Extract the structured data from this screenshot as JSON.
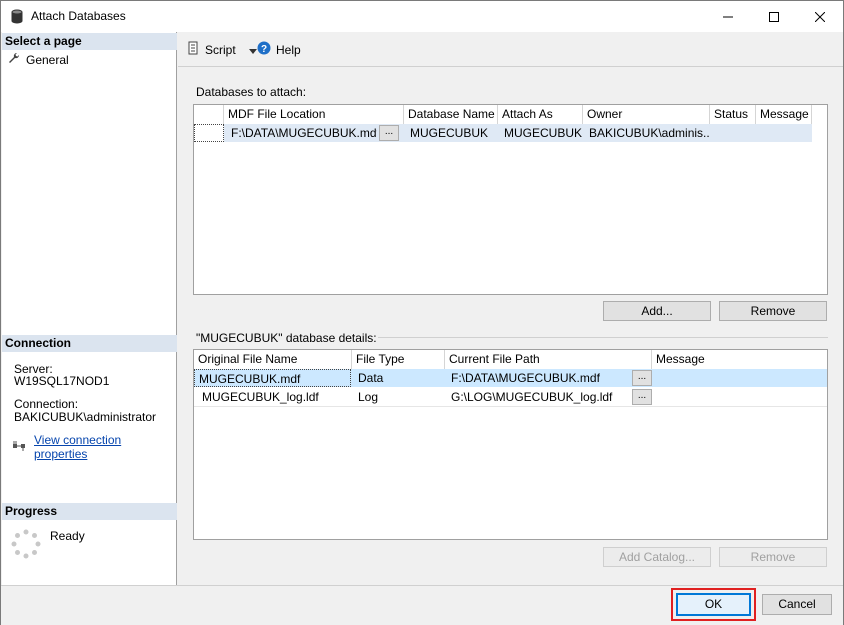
{
  "window": {
    "title": "Attach Databases"
  },
  "left": {
    "select_page_header": "Select a page",
    "pages": [
      {
        "label": "General"
      }
    ],
    "connection_header": "Connection",
    "server_label": "Server:",
    "server_value": "W19SQL17NOD1",
    "connection_label": "Connection:",
    "connection_value": "BAKICUBUK\\administrator",
    "view_connection_link": "View connection properties",
    "progress_header": "Progress",
    "progress_status": "Ready"
  },
  "toolbar": {
    "script_label": "Script",
    "help_label": "Help"
  },
  "databases": {
    "label": "Databases to attach:",
    "columns": [
      "MDF File Location",
      "Database Name",
      "Attach As",
      "Owner",
      "Status",
      "Message"
    ],
    "rows": [
      {
        "mdf": "F:\\DATA\\MUGECUBUK.mdf",
        "ellipsis": "...",
        "db_name": "MUGECUBUK",
        "attach_as": "MUGECUBUK",
        "owner": "BAKICUBUK\\adminis...",
        "status": "",
        "message": ""
      }
    ],
    "add_button": "Add...",
    "remove_button": "Remove"
  },
  "details": {
    "label": "\"MUGECUBUK\" database details:",
    "columns": [
      "Original File Name",
      "File Type",
      "Current File Path",
      "Message"
    ],
    "rows": [
      {
        "name": "MUGECUBUK.mdf",
        "type": "Data",
        "path": "F:\\DATA\\MUGECUBUK.mdf",
        "ellipsis": "...",
        "message": ""
      },
      {
        "name": "MUGECUBUK_log.ldf",
        "type": "Log",
        "path": "G:\\LOG\\MUGECUBUK_log.ldf",
        "ellipsis": "...",
        "message": ""
      }
    ],
    "add_catalog_button": "Add Catalog...",
    "remove_button": "Remove"
  },
  "footer": {
    "ok_label": "OK",
    "cancel_label": "Cancel"
  },
  "colors": {
    "selection": "#cce8ff",
    "section_header": "#dbe4ef",
    "ok_border": "#0078d7",
    "highlight": "#e02020",
    "link": "#0645ad"
  }
}
